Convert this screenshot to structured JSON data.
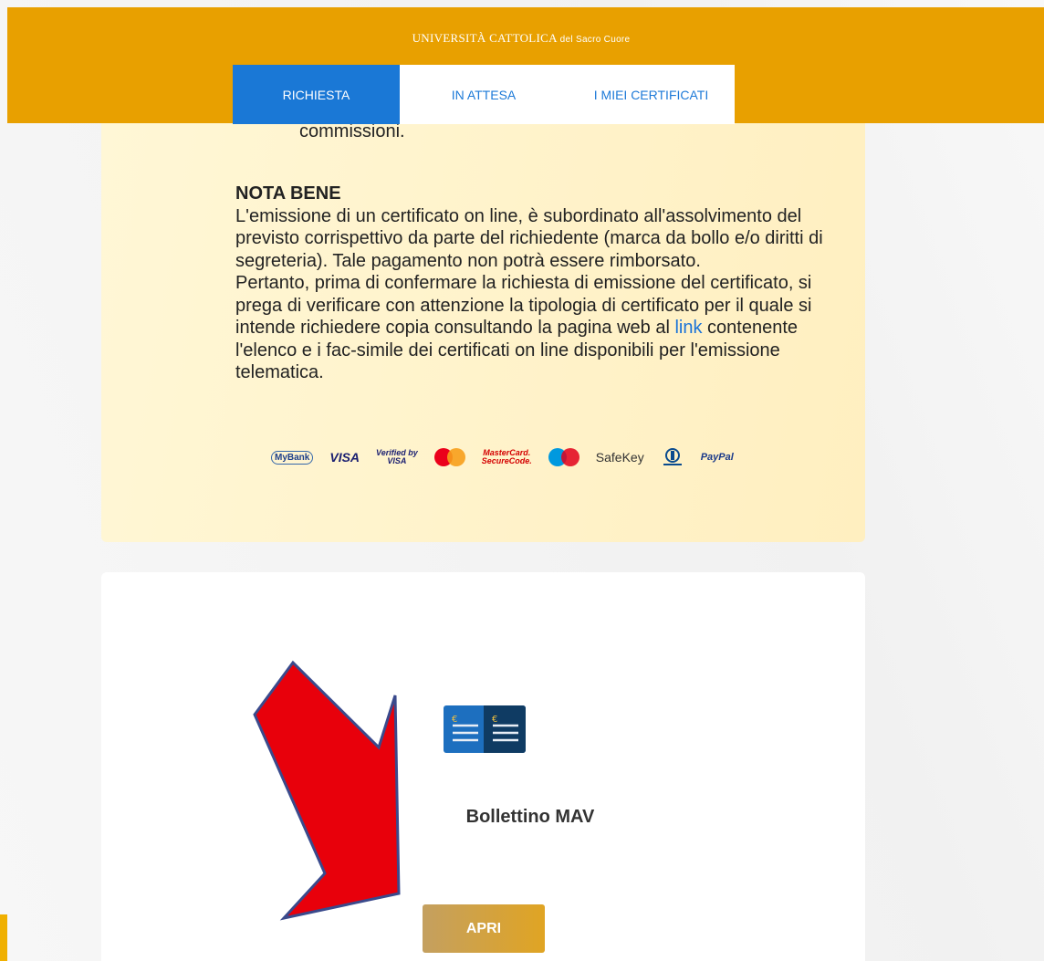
{
  "header": {
    "university_main": "UNIVERSITÀ CATTOLICA",
    "university_sub": "del Sacro Cuore",
    "color": "#e8a000"
  },
  "tabs": [
    {
      "label": "RICHIESTA",
      "active": true
    },
    {
      "label": "IN ATTESA",
      "active": false
    },
    {
      "label": "I MIEI CERTIFICATI",
      "active": false
    }
  ],
  "info": {
    "clipped_text": "commissioni.",
    "nota_title": "NOTA BENE",
    "nota_text_1": "L'emissione di un certificato on line, è subordinato all'assolvimento del previsto corrispettivo da parte del richiedente (marca da bollo e/o diritti di segreteria). Tale pagamento non potrà essere rimborsato.",
    "nota_text_2": "Pertanto, prima di confermare la richiesta di emissione del certificato, si prega di verificare con attenzione la tipologia di certificato per il quale si intende richiedere copia consultando la pagina web al",
    "link_text": "link",
    "nota_text_3": "contenente l'elenco e i fac-simile dei certificati on line disponibili per l'emissione telematica.",
    "payment_logos": {
      "mybank": "MyBank",
      "visa": "VISA",
      "vbv_1": "Verified by",
      "vbv_2": "VISA",
      "mc_sc_1": "MasterCard.",
      "mc_sc_2": "SecureCode.",
      "safekey": "SafeKey",
      "paypal": "PayPal"
    }
  },
  "payment_method": {
    "icon": "mav-bill-icon",
    "title": "Bollettino MAV",
    "button_label": "APRI"
  },
  "annotation": {
    "arrow_color": "#e8000b"
  }
}
